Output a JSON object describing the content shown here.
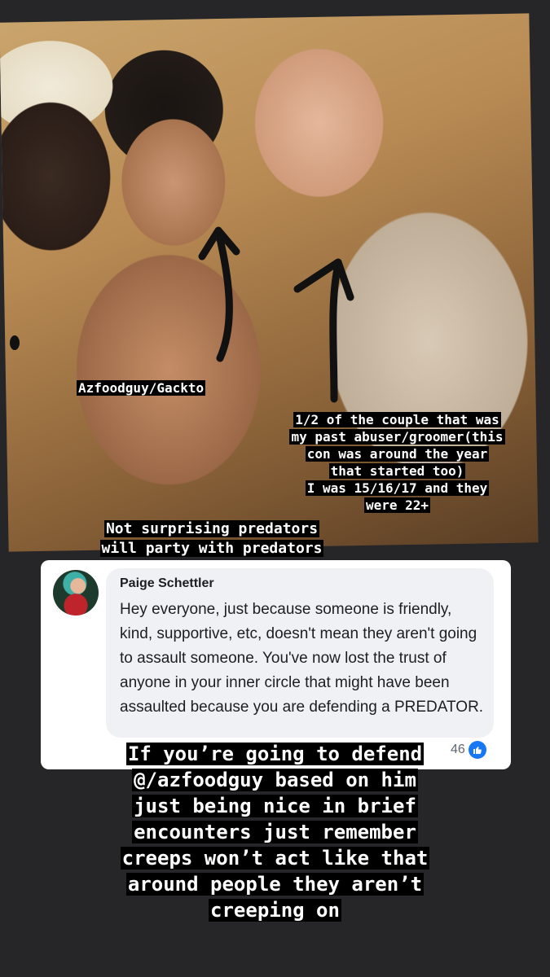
{
  "photo": {
    "captions": {
      "person_left": "Azfoodguy/Gackto",
      "person_right_lines": [
        "1/2 of the couple that was",
        "my past abuser/groomer(this",
        "con was around the year",
        "that started too)",
        "I was 15/16/17 and they",
        "were 22+"
      ],
      "predators_lines": [
        "Not surprising predators",
        "will party with predators"
      ]
    }
  },
  "comment": {
    "author": "Paige Schettler",
    "text": "Hey everyone, just because someone is friendly, kind, supportive, etc, doesn't mean they aren't going to assault someone. You've now lost the trust of anyone in your inner circle that might have been assaulted because you are defending a PREDATOR.",
    "reaction_count": "46",
    "reaction_icon": "like-icon",
    "reaction_color": "#1877f2"
  },
  "story_text_lines": [
    "If you’re going to defend",
    "@/azfoodguy based on him",
    "just being nice in brief",
    "encounters just remember",
    "creeps won’t act like that",
    "around people they aren’t",
    "creeping on"
  ]
}
